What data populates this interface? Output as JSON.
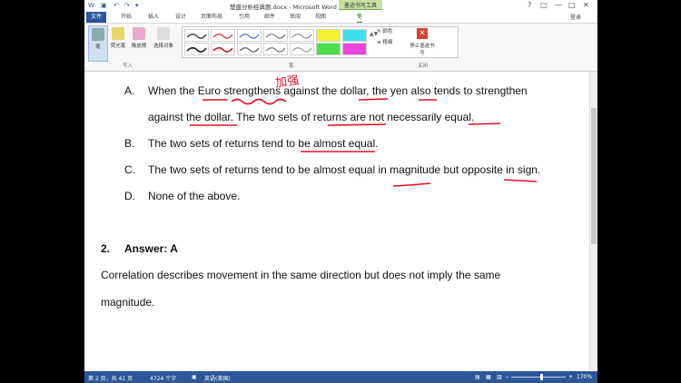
{
  "window": {
    "title": "楚盛分析经典题.docx - Microsoft Word",
    "context_tab": "墨迹书写工具",
    "signin": "登录",
    "controls": [
      "?",
      "□",
      "—",
      "□",
      "✕"
    ]
  },
  "ribbon_tabs": [
    "文件",
    "开始",
    "插入",
    "设计",
    "页面布局",
    "引用",
    "邮件",
    "审阅",
    "视图",
    "笔"
  ],
  "ribbon": {
    "pen_label": "笔",
    "highlighter_label": "荧光笔",
    "eraser_label": "橡皮擦",
    "select_label": "选择对象",
    "write_group": "写入",
    "pens_group": "笔",
    "color_label": "颜色",
    "thickness_label": "粗细",
    "stop_label": "停止墨迹书写",
    "close_group": "关闭"
  },
  "document": {
    "option_a_letter": "A.",
    "option_a_line1": "When the Euro strengthens against the dollar, the yen also tends to strengthen",
    "option_a_line2": "against the dollar. The two sets of returns are not necessarily equal.",
    "option_b_letter": "B.",
    "option_b": "The two sets of returns tend to be almost equal.",
    "option_c_letter": "C.",
    "option_c": "The two sets of returns tend to be almost equal in magnitude but opposite in sign.",
    "option_d_letter": "D.",
    "option_d": "None of the above.",
    "answer_number": "2.",
    "answer_label": "Answer: A",
    "explanation_line1": "Correlation describes movement in the same direction but does not imply the same",
    "explanation_line2": "magnitude.",
    "handwritten_note": "加强"
  },
  "status_bar": {
    "page": "第 2 页，共 41 页",
    "words": "4724 个字",
    "language": "英语(美国)",
    "zoom": "170%"
  },
  "colors": {
    "accent": "#2b579a",
    "ink": "#e0102a"
  }
}
